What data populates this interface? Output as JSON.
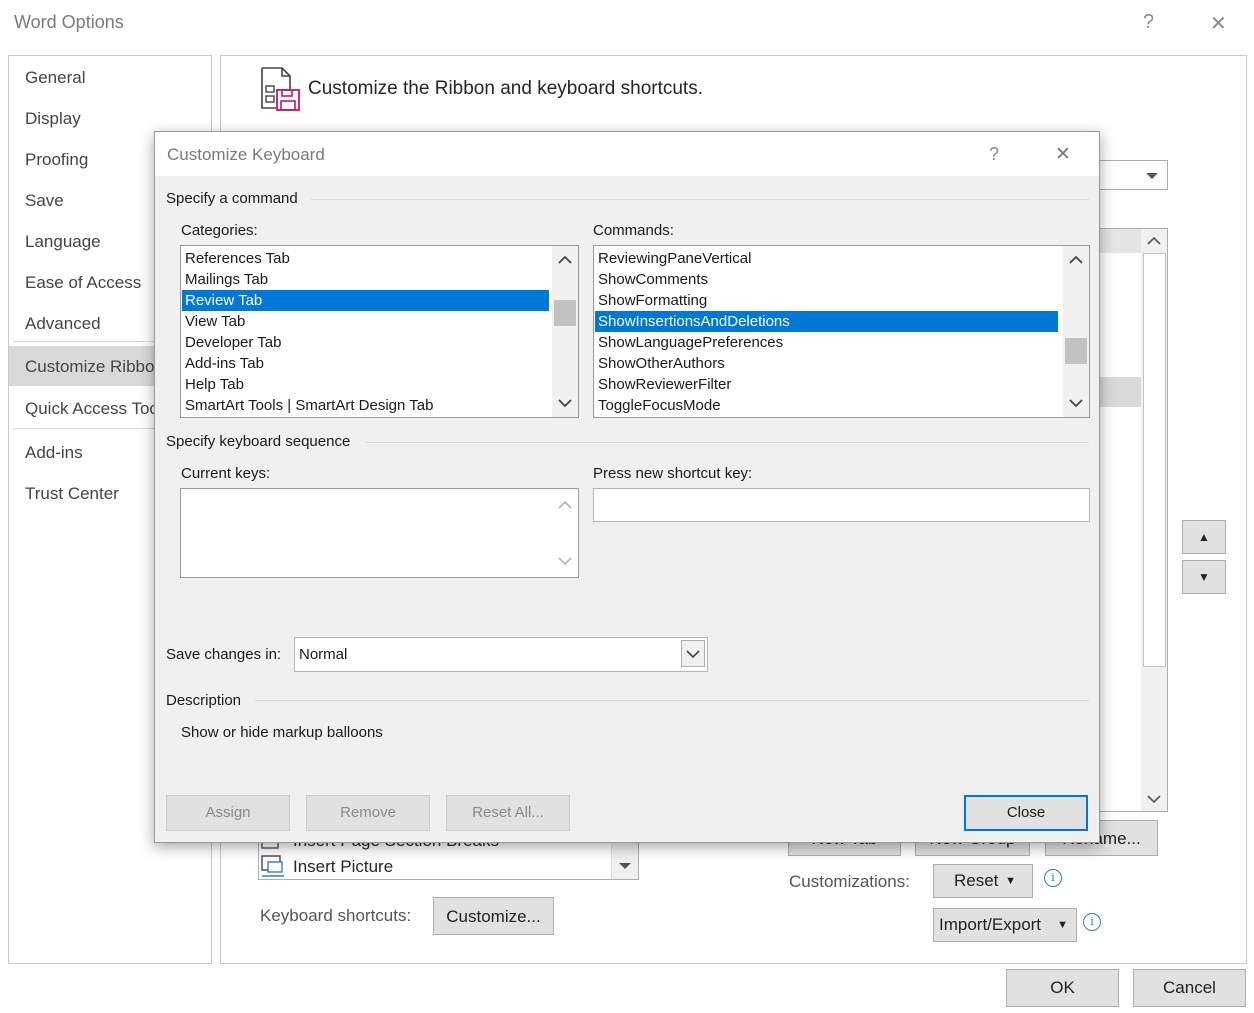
{
  "window": {
    "title": "Word Options",
    "help_glyph": "?",
    "close_glyph": "✕"
  },
  "nav": {
    "items": [
      {
        "label": "General"
      },
      {
        "label": "Display"
      },
      {
        "label": "Proofing"
      },
      {
        "label": "Save"
      },
      {
        "label": "Language"
      },
      {
        "label": "Ease of Access"
      },
      {
        "label": "Advanced"
      },
      {
        "label": "Customize Ribbon"
      },
      {
        "label": "Quick Access Toolbar"
      },
      {
        "label": "Add-ins"
      },
      {
        "label": "Trust Center"
      }
    ],
    "selected": "Customize Ribbon"
  },
  "main": {
    "heading": "Customize the Ribbon and keyboard shortcuts.",
    "bg_list_items": [
      "Insert Page  Section Breaks",
      "Insert Picture"
    ],
    "keyboard_shortcuts_label": "Keyboard shortcuts:",
    "customize_button": "Customize...",
    "new_tab_button": "New Tab",
    "new_group_button": "New Group",
    "rename_button": "Rename...",
    "customizations_label": "Customizations:",
    "reset_button": "Reset",
    "import_export_button": "Import/Export",
    "info_glyph": "i",
    "move_up_glyph": "▲",
    "move_down_glyph": "▼"
  },
  "footer": {
    "ok": "OK",
    "cancel": "Cancel"
  },
  "dialog": {
    "title": "Customize Keyboard",
    "help_glyph": "?",
    "close_glyph": "✕",
    "specify_command_label": "Specify a command",
    "categories_label": "Categories:",
    "categories": [
      "References Tab",
      "Mailings Tab",
      "Review Tab",
      "View Tab",
      "Developer Tab",
      "Add-ins Tab",
      "Help Tab",
      "SmartArt Tools | SmartArt Design Tab"
    ],
    "selected_category": "Review Tab",
    "commands_label": "Commands:",
    "commands": [
      "ReviewingPaneVertical",
      "ShowComments",
      "ShowFormatting",
      "ShowInsertionsAndDeletions",
      "ShowLanguagePreferences",
      "ShowOtherAuthors",
      "ShowReviewerFilter",
      "ToggleFocusMode"
    ],
    "selected_command": "ShowInsertionsAndDeletions",
    "keyboard_sequence_label": "Specify keyboard sequence",
    "current_keys_label": "Current keys:",
    "current_keys_value": "",
    "press_new_label": "Press new shortcut key:",
    "press_new_value": "",
    "save_changes_label": "Save changes in:",
    "save_changes_value": "Normal",
    "description_label": "Description",
    "description_text": "Show or hide markup balloons",
    "assign_button": "Assign",
    "remove_button": "Remove",
    "reset_all_button": "Reset All...",
    "close_button": "Close"
  },
  "colors": {
    "selection": "#0078d7",
    "nav_selected_bg": "#d9d9d9",
    "dialog_bg": "#f0f0f0",
    "close_button_border": "#0078d7",
    "info_icon": "#2b7cd3",
    "icon_magenta": "#c0157a"
  }
}
